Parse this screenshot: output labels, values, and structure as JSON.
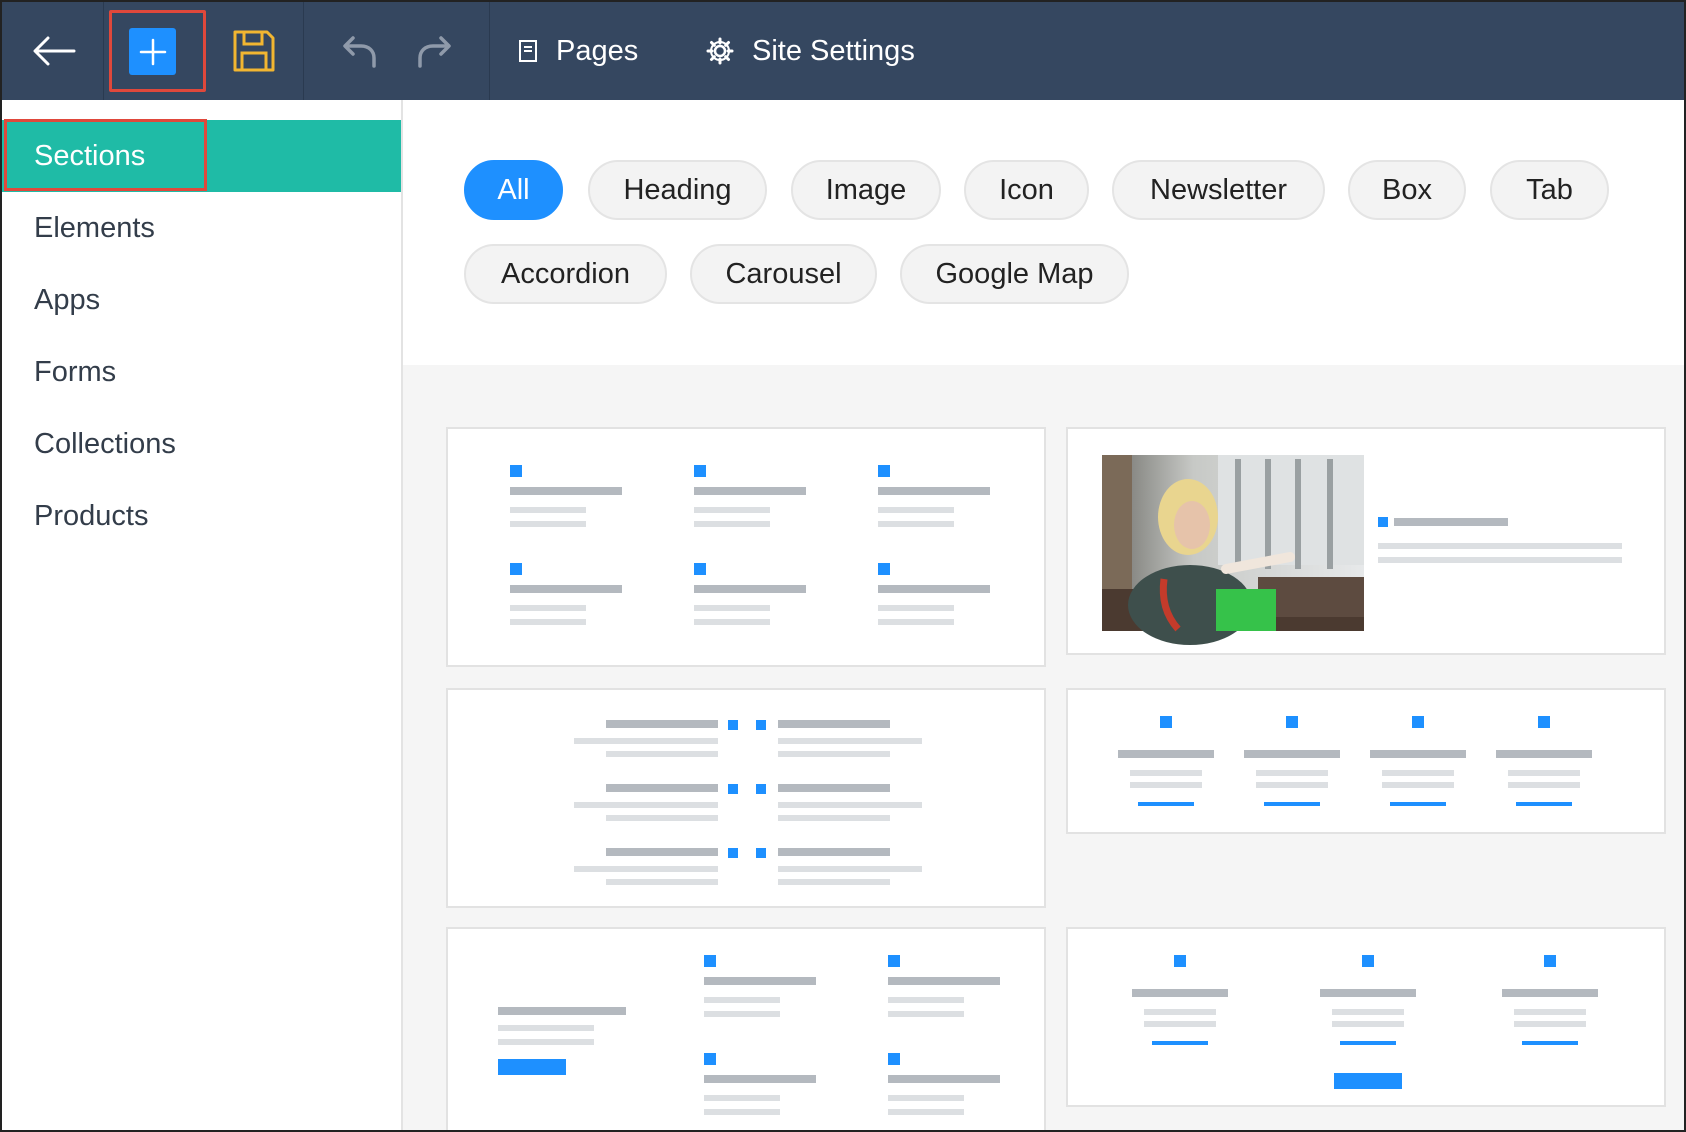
{
  "toolbar": {
    "back_icon": "arrow-left-icon",
    "add_icon": "plus-icon",
    "save_icon": "floppy-disk-icon",
    "undo_icon": "undo-icon",
    "redo_icon": "redo-icon",
    "pages_label": "Pages",
    "pages_icon": "page-icon",
    "site_settings_label": "Site Settings",
    "site_settings_icon": "gear-icon"
  },
  "sidebar": {
    "items": [
      {
        "label": "Sections",
        "active": true
      },
      {
        "label": "Elements"
      },
      {
        "label": "Apps"
      },
      {
        "label": "Forms"
      },
      {
        "label": "Collections"
      },
      {
        "label": "Products"
      }
    ]
  },
  "filters": {
    "chips": [
      {
        "label": "All",
        "active": true
      },
      {
        "label": "Heading"
      },
      {
        "label": "Image"
      },
      {
        "label": "Icon"
      },
      {
        "label": "Newsletter"
      },
      {
        "label": "Box"
      },
      {
        "label": "Tab"
      },
      {
        "label": "Accordion"
      },
      {
        "label": "Carousel"
      },
      {
        "label": "Google Map"
      }
    ]
  },
  "colors": {
    "topbar": "#354760",
    "accent_blue": "#1e90ff",
    "sidebar_active": "#1fbba6",
    "highlight_red": "#e0483b",
    "save_icon": "#f2b631",
    "placeholder_dark": "#b4b9bf",
    "placeholder_light": "#dcdfe2"
  }
}
